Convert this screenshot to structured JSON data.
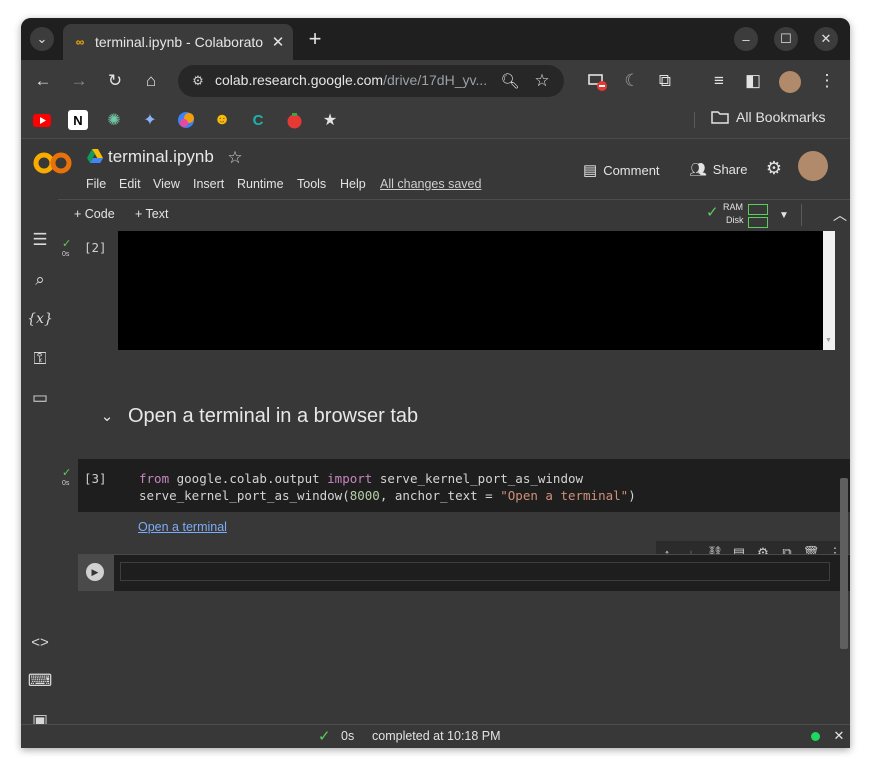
{
  "browser": {
    "tab_title": "terminal.ipynb - Colaboratory",
    "url_host": "colab.research.google.com",
    "url_rest": "/drive/17dH_yv...",
    "all_bookmarks": "All Bookmarks"
  },
  "colab": {
    "logo": "CO",
    "notebook_title": "terminal.ipynb",
    "menu": [
      "File",
      "Edit",
      "View",
      "Insert",
      "Runtime",
      "Tools",
      "Help"
    ],
    "saved_status": "All changes saved",
    "comment_label": "Comment",
    "share_label": "Share",
    "add_code": "Code",
    "add_text": "Text",
    "ram_label": "RAM",
    "disk_label": "Disk"
  },
  "cells": {
    "cell2": {
      "exec_count": "[2]",
      "time": "0s"
    },
    "section_heading": "Open a terminal in a browser tab",
    "cell3": {
      "exec_count": "[3]",
      "time": "0s",
      "line1_a": "from",
      "line1_b": " google.colab.output ",
      "line1_c": "import",
      "line1_d": " serve_kernel_port_as_window",
      "line2_a": "serve_kernel_port_as_window(",
      "line2_b": "8000",
      "line2_c": ", anchor_text = ",
      "line2_d": "\"Open a terminal\"",
      "line2_e": ")",
      "output_link": "Open a terminal"
    }
  },
  "status": {
    "elapsed": "0s",
    "completed": "completed at 10:18 PM"
  },
  "colors": {
    "colab_orange": "#f9ab00",
    "check_green": "#5ccd5c",
    "link_blue": "#7cacf8",
    "connected_dot": "#1ed760"
  }
}
